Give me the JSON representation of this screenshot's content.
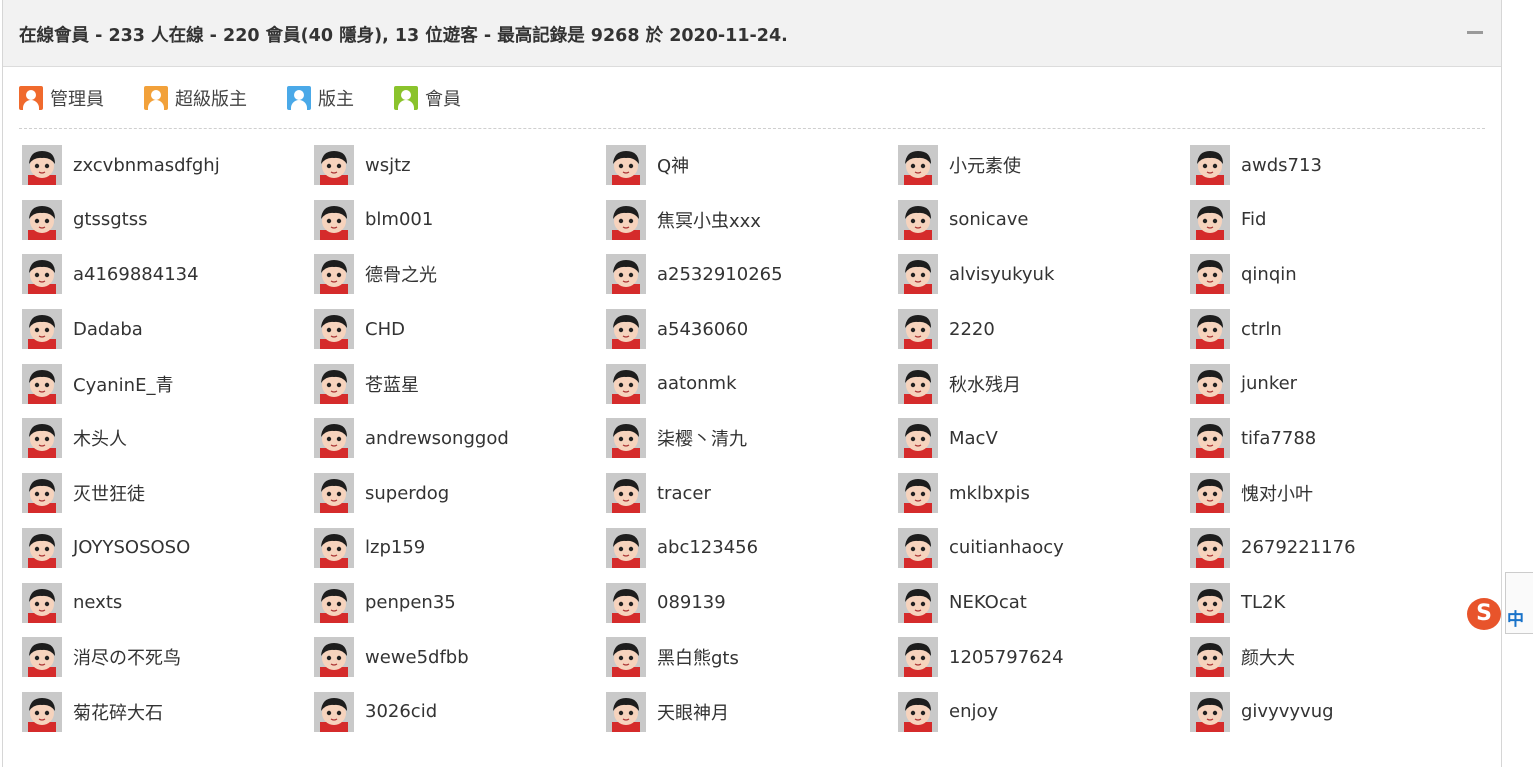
{
  "header": {
    "title": "在線會員 - 233 人在線 - 220 會員(40 隱身), 13 位遊客 - 最高記錄是 9268 於 2020-11-24."
  },
  "legend": [
    {
      "label": "管理員",
      "color": "#f06a2d"
    },
    {
      "label": "超級版主",
      "color": "#f2a13a"
    },
    {
      "label": "版主",
      "color": "#4aa9e8"
    },
    {
      "label": "會員",
      "color": "#8ac32c"
    }
  ],
  "members": [
    "zxcvbnmasdfghj",
    "wsjtz",
    "Q神",
    "小元素使",
    "awds713",
    "gtssgtss",
    "blm001",
    "焦冥小虫xxx",
    "sonicave",
    "Fid",
    "a4169884134",
    "德骨之光",
    "a2532910265",
    "alvisyukyuk",
    "qinqin",
    "Dadaba",
    "CHD",
    "a5436060",
    "2220",
    "ctrln",
    "CyaninE_青",
    "苍蓝星",
    "aatonmk",
    "秋水残月",
    "junker",
    "木头人",
    "andrewsonggod",
    "柒樱丶清九",
    "MacV",
    "tifa7788",
    "灭世狂徒",
    "superdog",
    "tracer",
    "mklbxpis",
    "愧对小叶",
    "JOYYSOSOSO",
    "lzp159",
    "abc123456",
    "cuitianhaocy",
    "2679221176",
    "nexts",
    "penpen35",
    "089139",
    "NEKOcat",
    "TL2K",
    "消尽の不死鸟",
    "wewe5dfbb",
    "黑白熊gts",
    "1205797624",
    "颜大大",
    "菊花碎大石",
    "3026cid",
    "天眼神月",
    "enjoy",
    "givyvyvug"
  ],
  "ime": {
    "logo": "S",
    "mode": "中"
  }
}
